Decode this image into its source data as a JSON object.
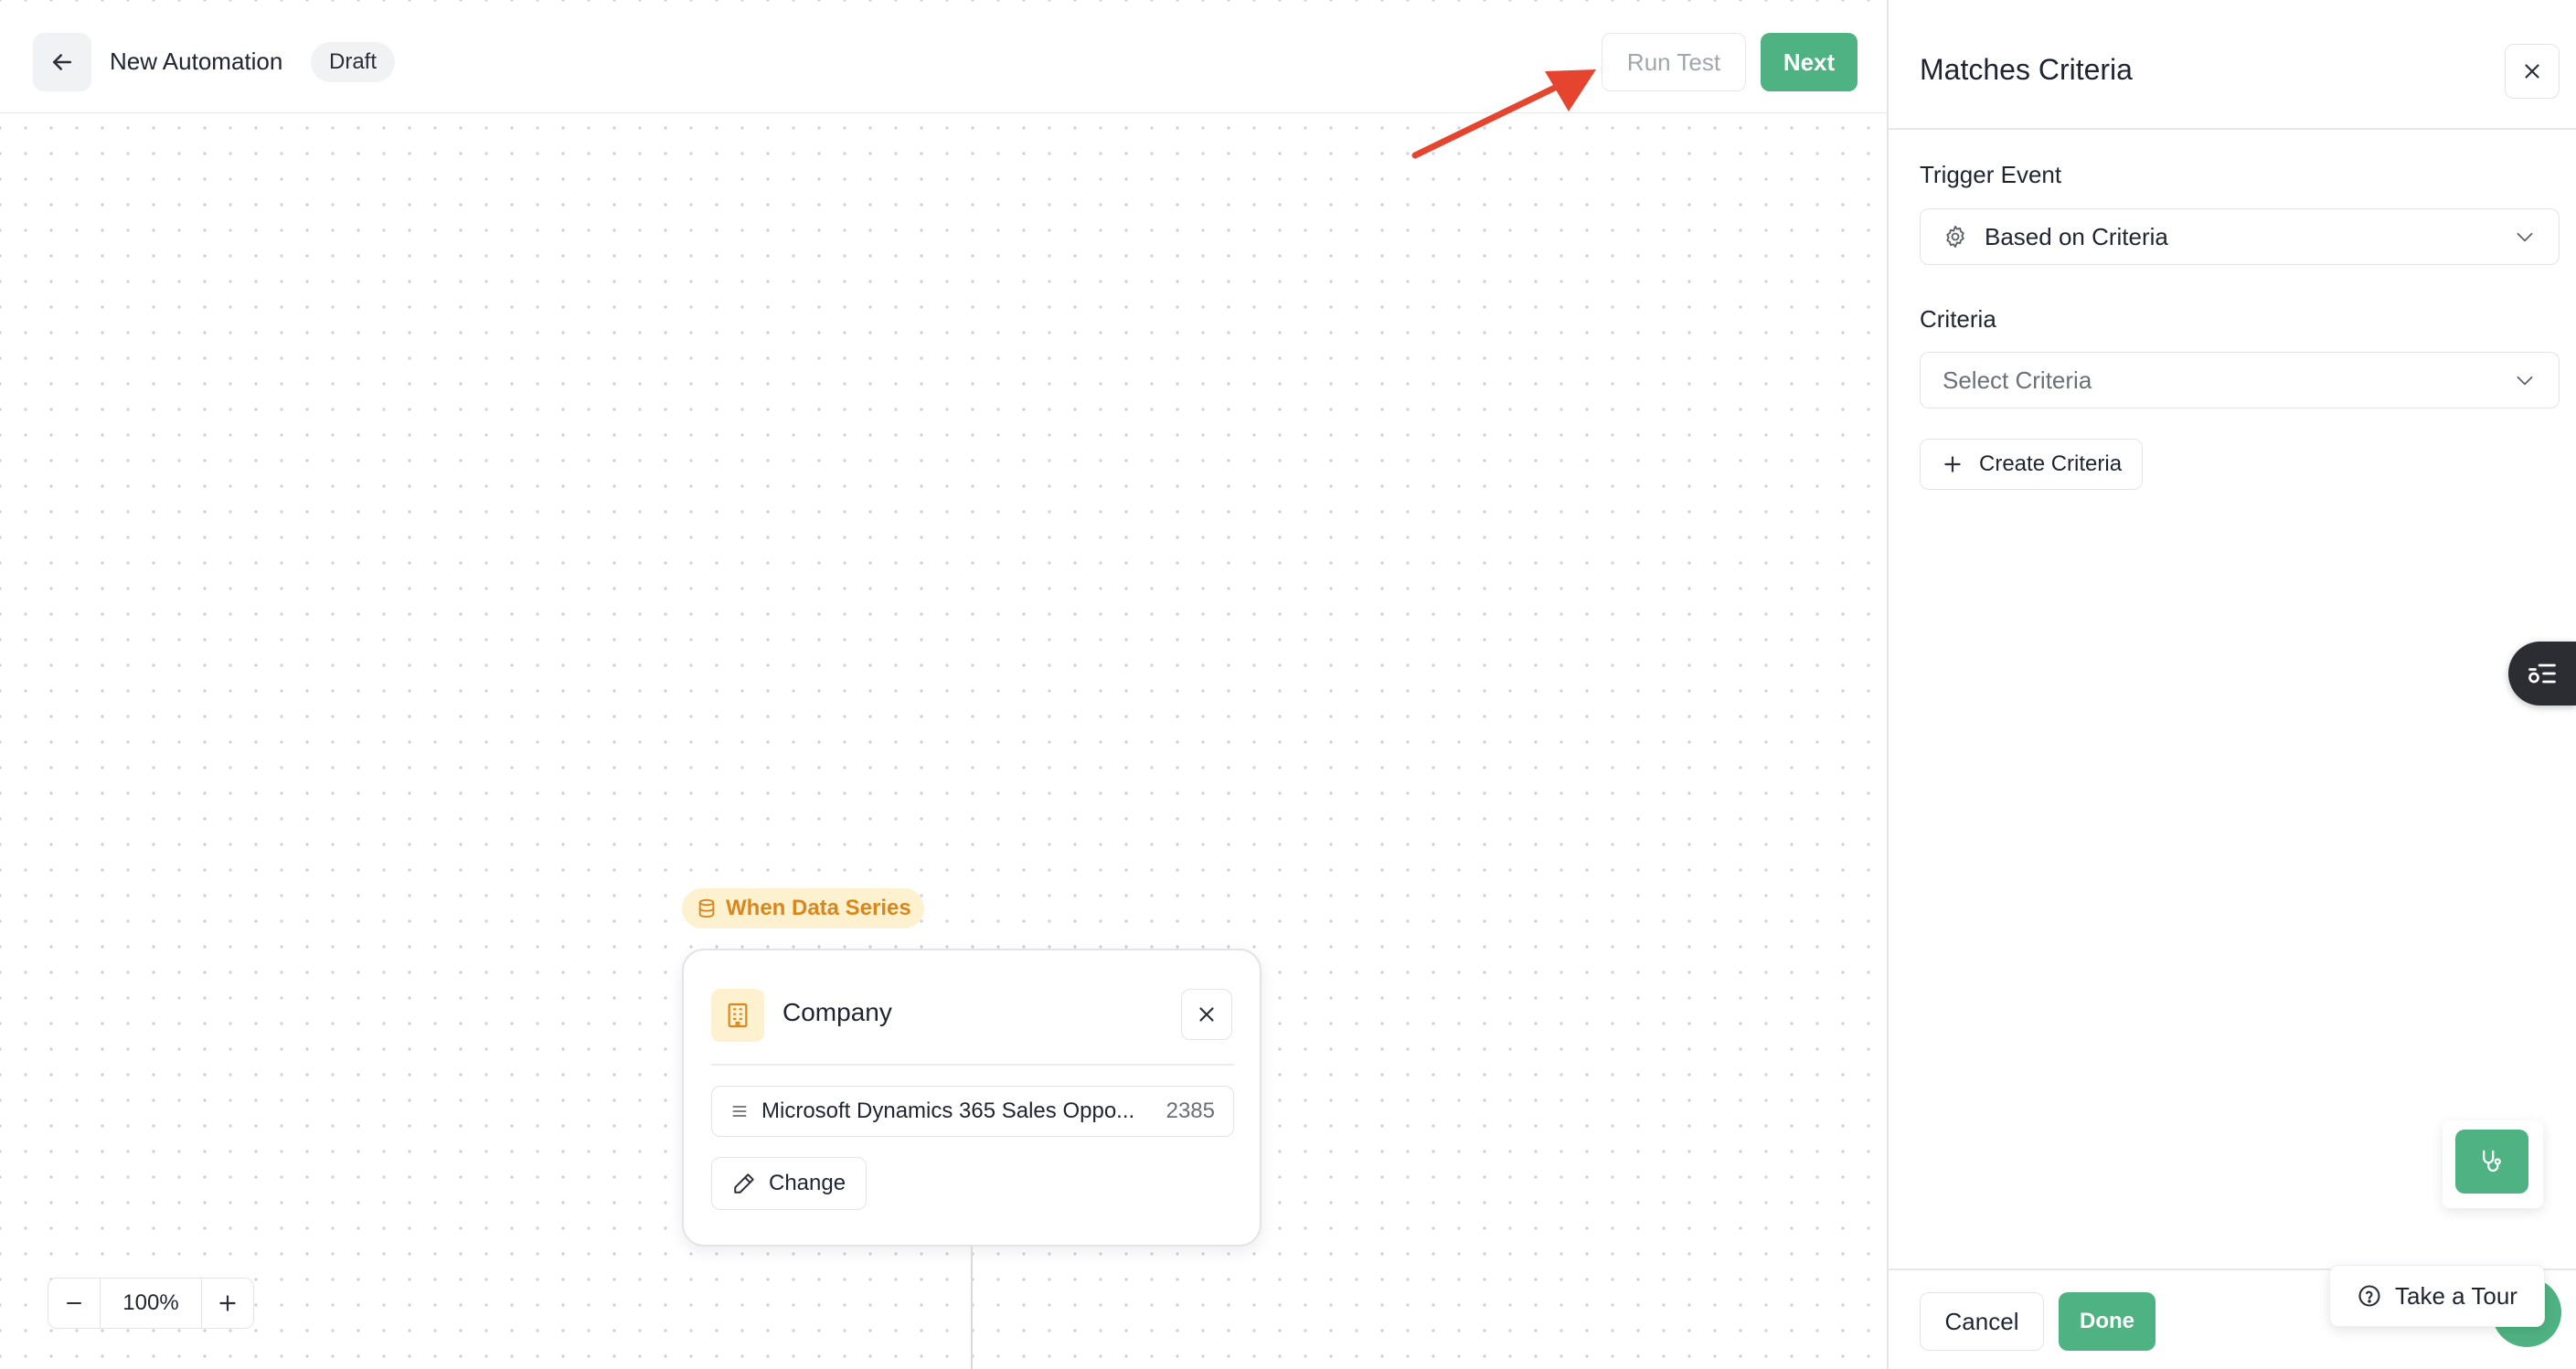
{
  "header": {
    "title": "New Automation",
    "status_badge": "Draft",
    "run_test_label": "Run Test",
    "next_label": "Next"
  },
  "node": {
    "tag_label": "When Data Series",
    "title": "Company",
    "source_name": "Microsoft Dynamics 365 Sales Oppo...",
    "source_count": "2385",
    "change_label": "Change"
  },
  "zoom": {
    "level": "100%"
  },
  "panel": {
    "title": "Matches Criteria",
    "trigger_event_label": "Trigger Event",
    "trigger_event_value": "Based on Criteria",
    "criteria_label": "Criteria",
    "criteria_placeholder": "Select Criteria",
    "create_criteria_label": "Create Criteria",
    "cancel_label": "Cancel",
    "done_label": "Done"
  },
  "widgets": {
    "tour_label": "Take a Tour"
  },
  "colors": {
    "accent_green": "#4fb282",
    "tag_orange": "#d9861c",
    "tag_bg": "#fdf1cf",
    "annotation_red": "#e5452f"
  },
  "icons": [
    "arrow-left-icon",
    "annotation-arrow",
    "database-icon",
    "building-icon",
    "close-icon",
    "list-icon",
    "pencil-icon",
    "minus-icon",
    "plus-icon",
    "gear-icon",
    "chevron-down-icon",
    "filter-list-icon",
    "stethoscope-icon",
    "help-circle-icon"
  ]
}
